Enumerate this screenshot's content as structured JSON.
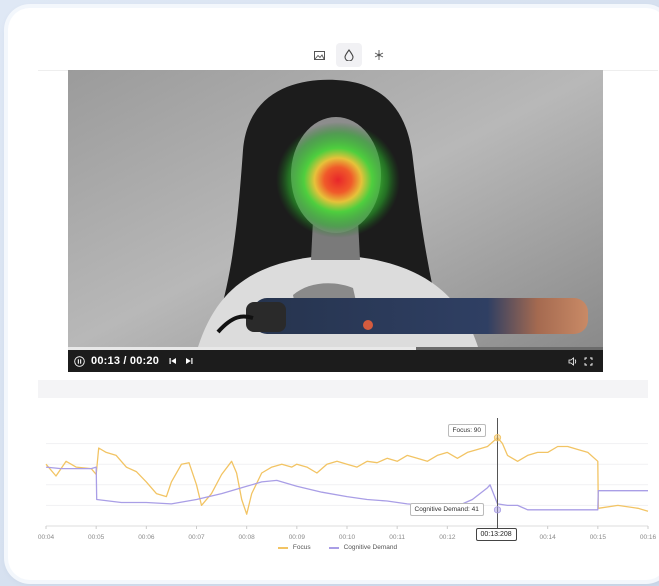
{
  "toolbar": {
    "items": [
      {
        "icon": "image-icon",
        "active": false
      },
      {
        "icon": "heatmap-drop-icon",
        "active": true
      },
      {
        "icon": "gaze-icon",
        "active": false
      }
    ]
  },
  "video": {
    "time_display": "00:13 / 00:20",
    "progress": 0.65
  },
  "chart_data": {
    "type": "line",
    "x_ticks": [
      "00:04",
      "00:05",
      "00:06",
      "00:07",
      "00:08",
      "00:09",
      "00:10",
      "00:11",
      "00:12",
      "00:13",
      "00:14",
      "00:15",
      "00:16"
    ],
    "series": [
      {
        "name": "Focus",
        "color": "#f2c464",
        "x": [
          4.0,
          4.2,
          4.4,
          4.6,
          4.9,
          5.0,
          5.05,
          5.2,
          5.4,
          5.6,
          5.8,
          6.0,
          6.2,
          6.4,
          6.5,
          6.7,
          6.85,
          7.0,
          7.1,
          7.3,
          7.5,
          7.7,
          7.8,
          7.9,
          8.0,
          8.1,
          8.3,
          8.5,
          8.7,
          8.9,
          9.0,
          9.2,
          9.4,
          9.6,
          9.8,
          10.0,
          10.2,
          10.4,
          10.6,
          10.8,
          11.0,
          11.2,
          11.4,
          11.6,
          11.8,
          12.0,
          12.2,
          12.4,
          12.6,
          12.8,
          13.0,
          13.1,
          13.2,
          13.4,
          13.6,
          13.8,
          14.0,
          14.2,
          14.4,
          14.6,
          14.8,
          15.0,
          15.01,
          15.4,
          15.8,
          16.0
        ],
        "y": [
          72,
          64,
          74,
          70,
          69,
          65,
          83,
          80,
          78,
          70,
          67,
          60,
          52,
          50,
          60,
          72,
          73,
          58,
          44,
          52,
          65,
          74,
          66,
          48,
          38,
          52,
          66,
          70,
          72,
          70,
          72,
          70,
          66,
          72,
          74,
          72,
          70,
          74,
          73,
          76,
          74,
          78,
          76,
          74,
          78,
          80,
          76,
          80,
          82,
          84,
          90,
          86,
          78,
          74,
          78,
          80,
          80,
          84,
          84,
          82,
          80,
          74,
          42,
          44,
          42,
          40
        ]
      },
      {
        "name": "Cognitive Demand",
        "color": "#a99ee6",
        "x": [
          4.0,
          4.3,
          4.6,
          4.9,
          5.0,
          5.01,
          5.5,
          6.0,
          6.5,
          7.0,
          7.5,
          8.0,
          8.3,
          8.6,
          9.0,
          9.5,
          10.0,
          10.4,
          10.8,
          11.2,
          11.6,
          12.0,
          12.3,
          12.5,
          12.8,
          12.85,
          13.0,
          13.2,
          13.4,
          13.6,
          13.9,
          14.0,
          14.5,
          15.0,
          15.01,
          15.5,
          16.0
        ],
        "y": [
          70,
          69,
          69,
          69,
          70,
          48,
          46,
          46,
          45,
          48,
          52,
          57,
          60,
          61,
          57,
          53,
          50,
          48,
          47,
          45,
          44,
          43,
          45,
          48,
          56,
          58,
          45,
          44,
          44,
          41,
          41,
          41,
          41,
          41,
          54,
          54,
          54
        ]
      }
    ],
    "xlim": [
      4.0,
      16.0
    ],
    "ylim": [
      30,
      100
    ],
    "cursor_x": 13.0,
    "cursor_label": "00:13:208",
    "tooltips": [
      {
        "series": "Focus",
        "label": "Focus: 90",
        "value": 90
      },
      {
        "series": "Cognitive Demand",
        "label": "Cognitive Demand: 41",
        "value": 41
      }
    ],
    "legend": [
      "Focus",
      "Cognitive Demand"
    ]
  }
}
